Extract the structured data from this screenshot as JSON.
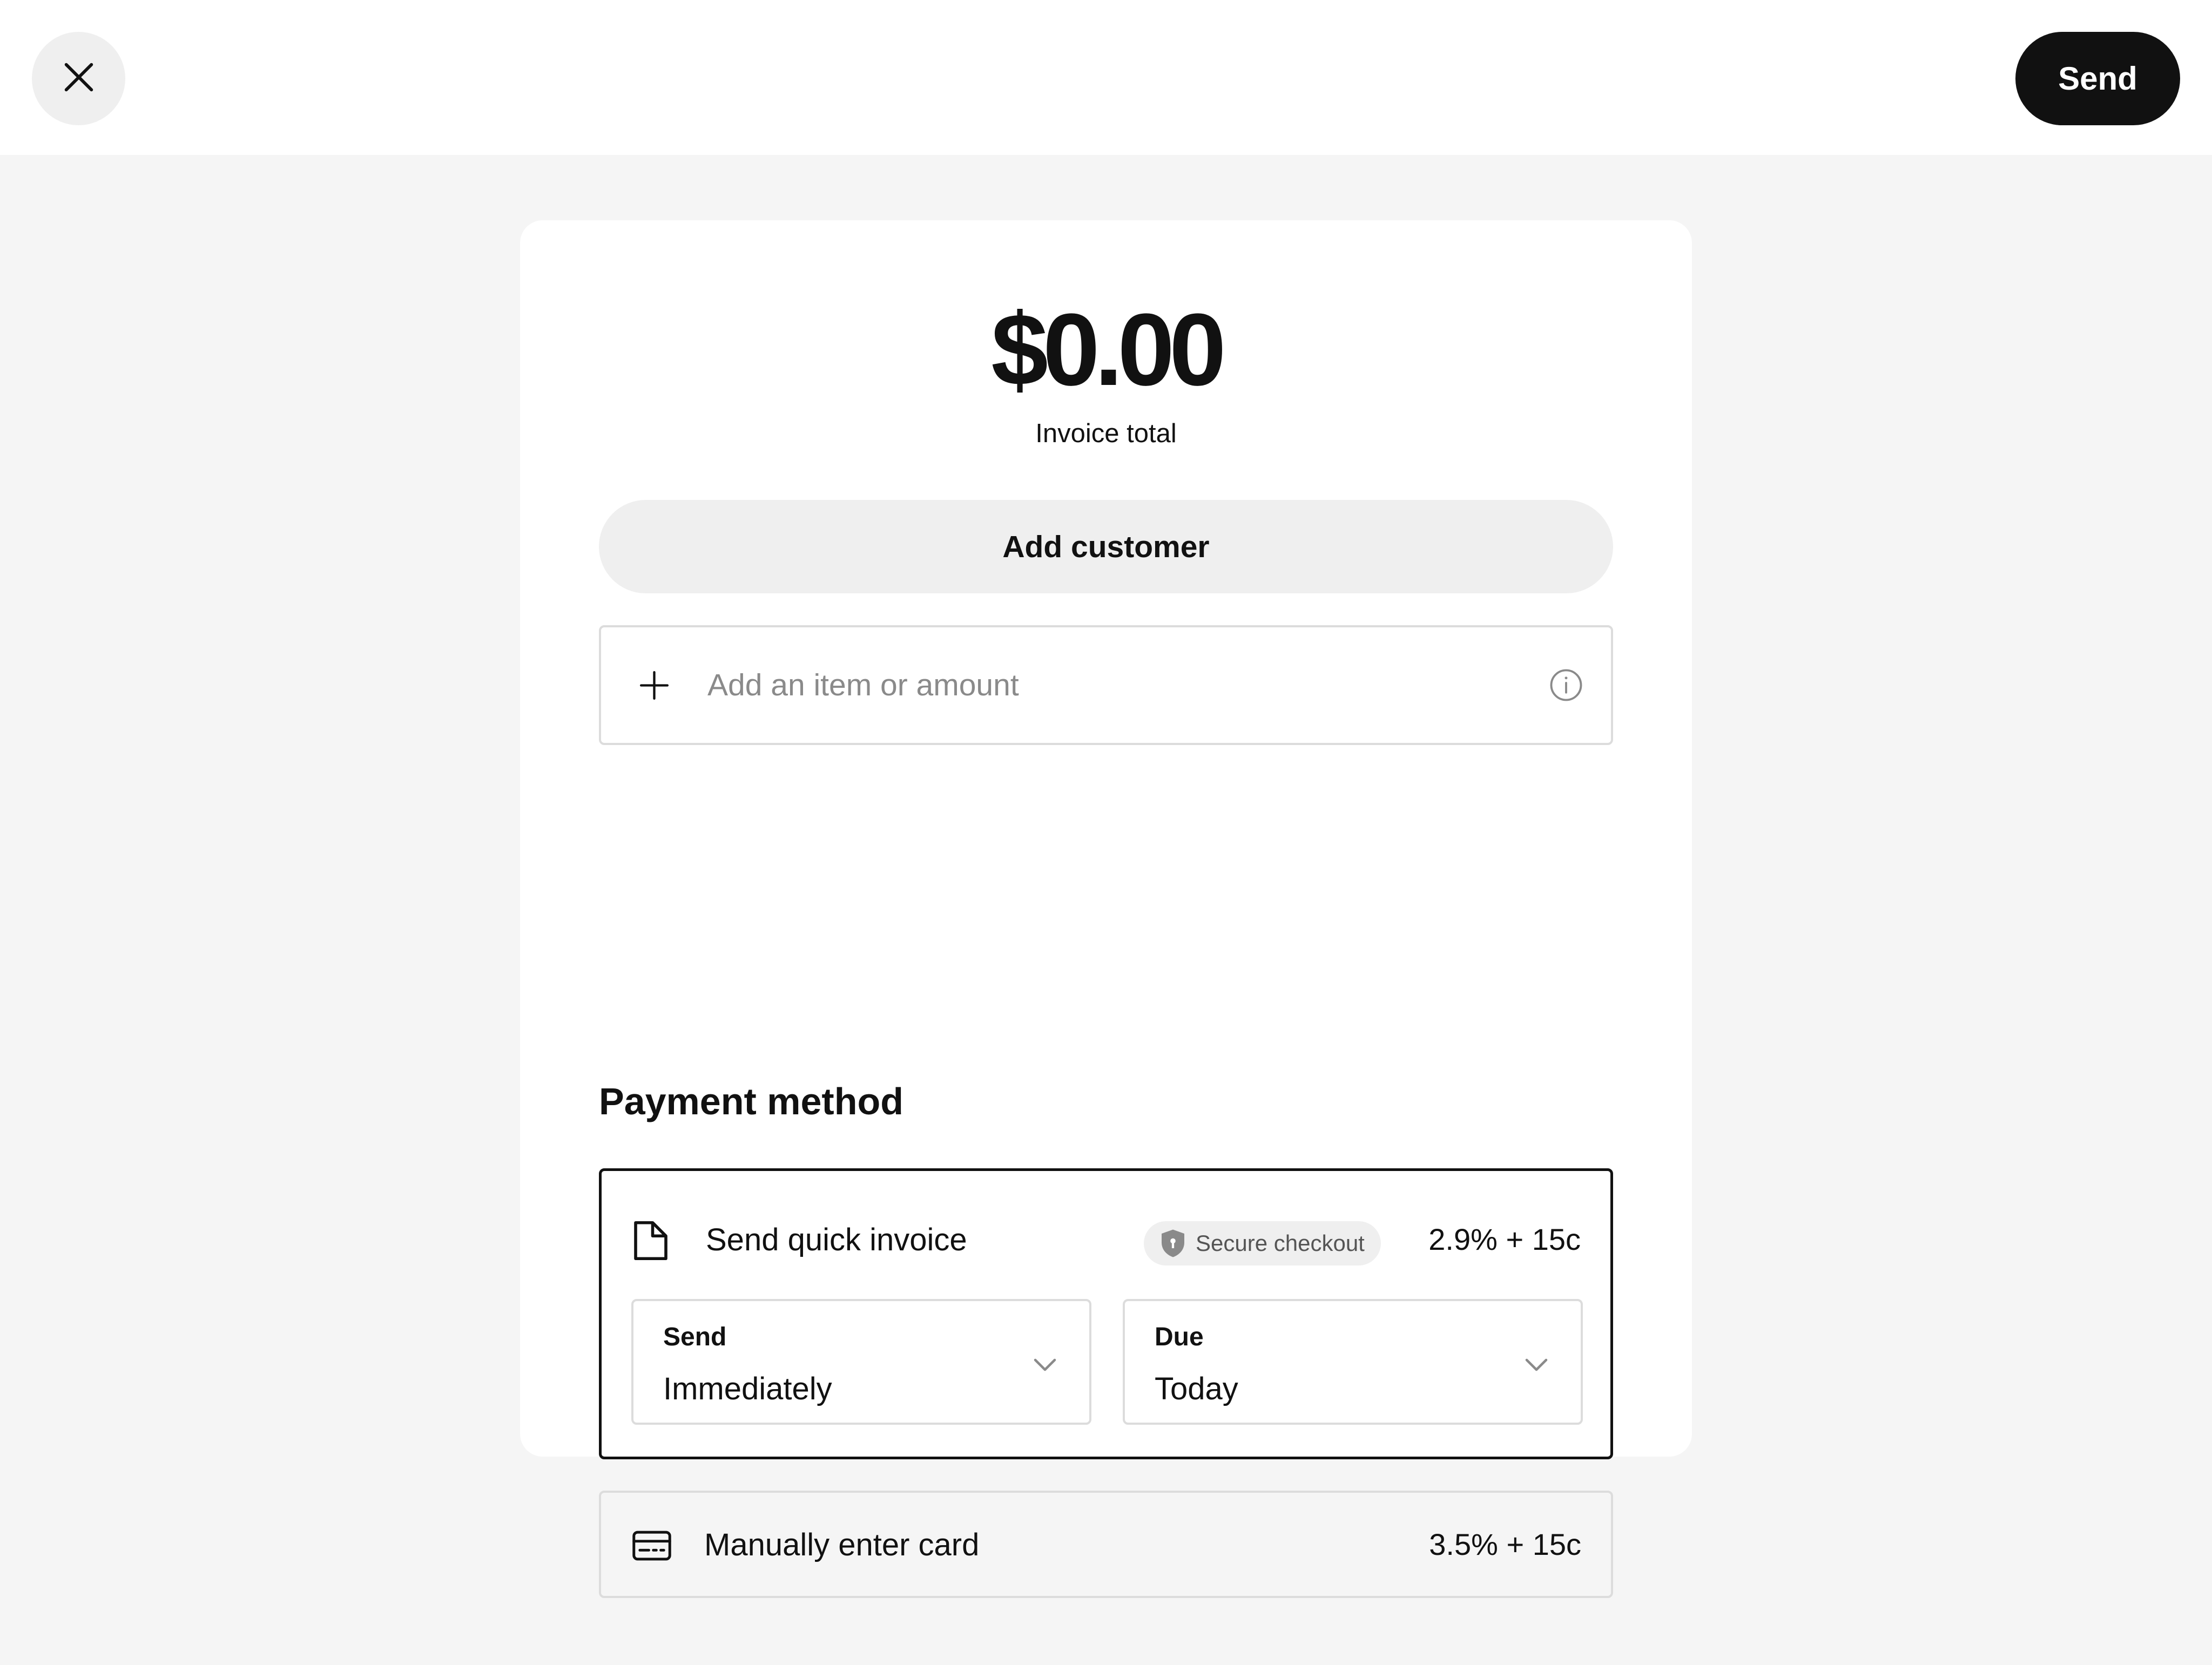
{
  "topbar": {
    "close_icon": "close-icon",
    "send_label": "Send"
  },
  "invoice": {
    "total": "$0.00",
    "total_label": "Invoice total",
    "add_customer_label": "Add customer",
    "item_placeholder": "Add an item or amount",
    "item_value": ""
  },
  "payment": {
    "section_title": "Payment method",
    "quick_invoice": {
      "title": "Send quick invoice",
      "badge": "Secure checkout",
      "fee": "2.9% + 15c",
      "send_select": {
        "label": "Send",
        "value": "Immediately"
      },
      "due_select": {
        "label": "Due",
        "value": "Today"
      },
      "selected": true
    },
    "manual_card": {
      "title": "Manually enter card",
      "fee": "3.5% + 15c"
    }
  },
  "colors": {
    "primary": "#111111",
    "background": "#f5f5f5",
    "surface": "#ffffff",
    "muted_fill": "#efefef",
    "border": "#dcdcdc",
    "placeholder": "#8a8a8a"
  }
}
